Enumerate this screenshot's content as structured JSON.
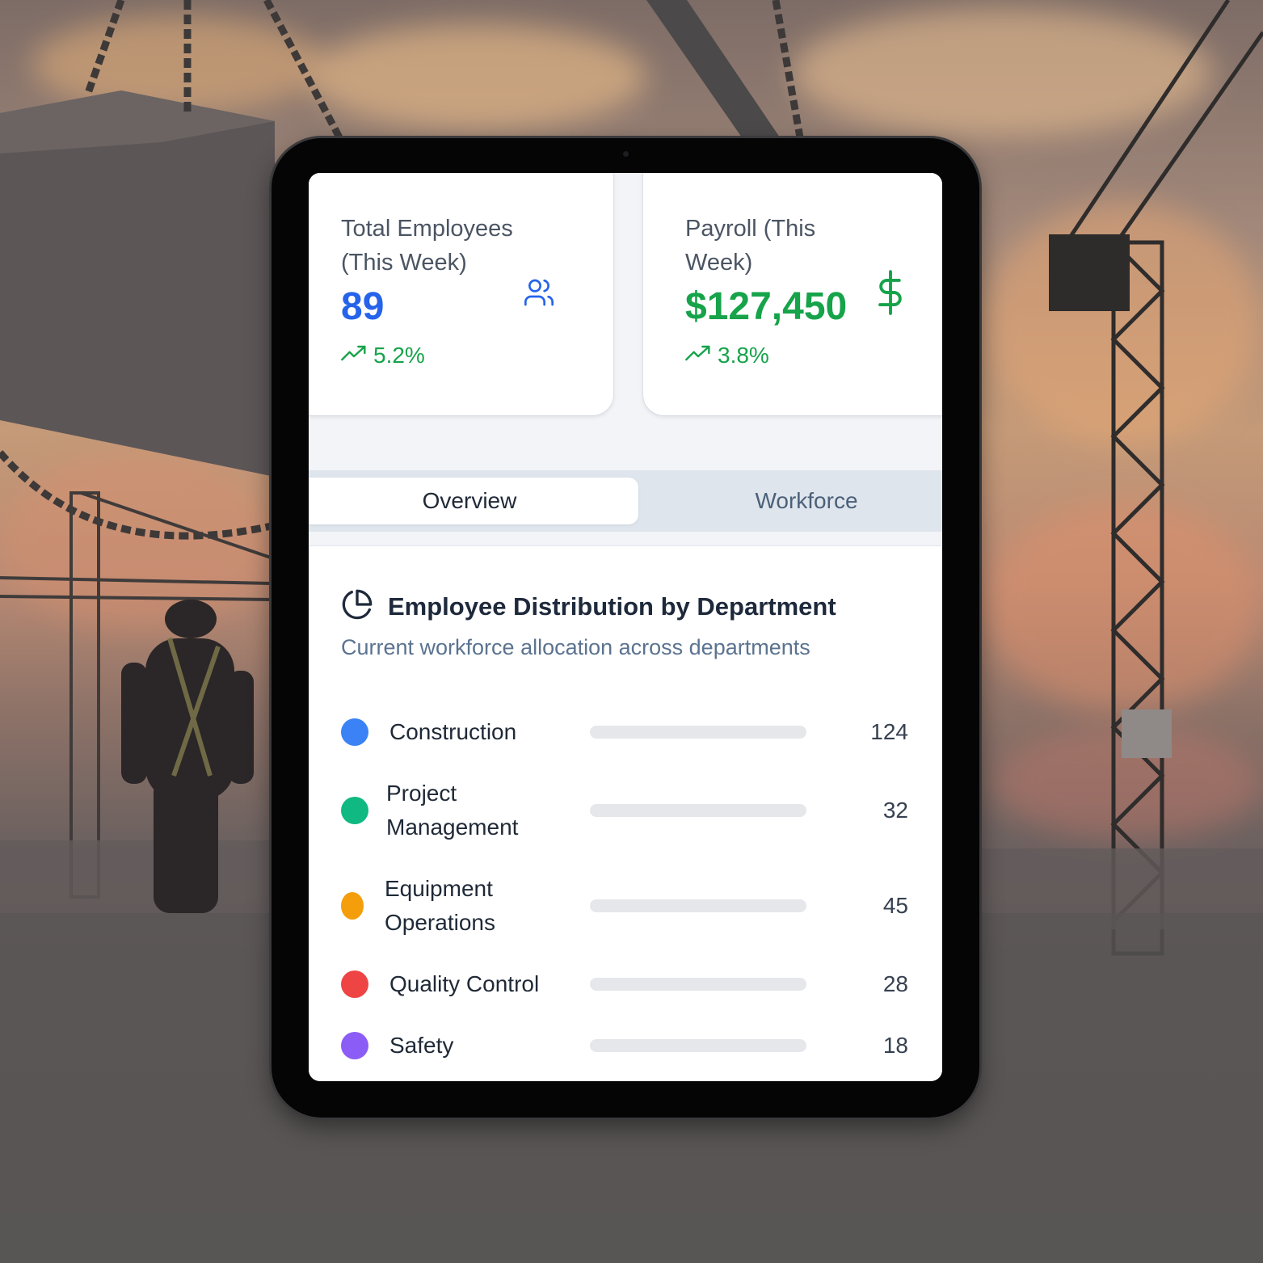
{
  "stats": {
    "employees": {
      "title": "Total Employees (This Week)",
      "value": "89",
      "trend": "5.2%",
      "icon": "users-icon"
    },
    "payroll": {
      "title": "Payroll (This Week)",
      "value": "$127,450",
      "trend": "3.8%",
      "icon": "dollar-icon"
    }
  },
  "tabs": [
    {
      "label": "Overview",
      "active": true
    },
    {
      "label": "Workforce",
      "active": false
    }
  ],
  "panel": {
    "title": "Employee Distribution by Department",
    "subtitle": "Current workforce allocation across departments",
    "icon": "pie-chart-icon"
  },
  "departments": [
    {
      "name": "Construction",
      "count": "124",
      "value": 124,
      "color": "#3b82f6"
    },
    {
      "name": "Project Management",
      "count": "32",
      "value": 32,
      "color": "#10b981"
    },
    {
      "name": "Equipment Operations",
      "count": "45",
      "value": 45,
      "color": "#f59e0b"
    },
    {
      "name": "Quality Control",
      "count": "28",
      "value": 28,
      "color": "#ef4444"
    },
    {
      "name": "Safety",
      "count": "18",
      "value": 18,
      "color": "#8b5cf6"
    }
  ],
  "colors": {
    "primary": "#2563eb",
    "success": "#16a34a"
  }
}
